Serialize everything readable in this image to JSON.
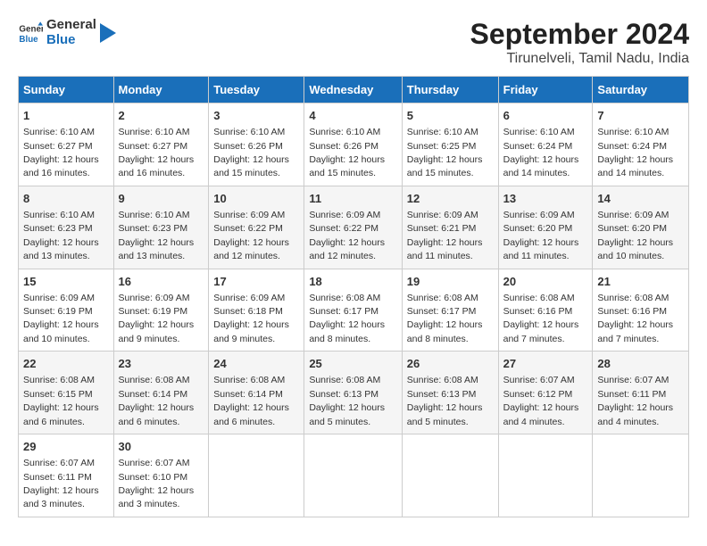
{
  "header": {
    "logo_line1": "General",
    "logo_line2": "Blue",
    "title": "September 2024",
    "subtitle": "Tirunelveli, Tamil Nadu, India"
  },
  "days_of_week": [
    "Sunday",
    "Monday",
    "Tuesday",
    "Wednesday",
    "Thursday",
    "Friday",
    "Saturday"
  ],
  "weeks": [
    [
      {
        "day": "1",
        "sunrise": "6:10 AM",
        "sunset": "6:27 PM",
        "daylight": "12 hours and 16 minutes."
      },
      {
        "day": "2",
        "sunrise": "6:10 AM",
        "sunset": "6:27 PM",
        "daylight": "12 hours and 16 minutes."
      },
      {
        "day": "3",
        "sunrise": "6:10 AM",
        "sunset": "6:26 PM",
        "daylight": "12 hours and 15 minutes."
      },
      {
        "day": "4",
        "sunrise": "6:10 AM",
        "sunset": "6:26 PM",
        "daylight": "12 hours and 15 minutes."
      },
      {
        "day": "5",
        "sunrise": "6:10 AM",
        "sunset": "6:25 PM",
        "daylight": "12 hours and 15 minutes."
      },
      {
        "day": "6",
        "sunrise": "6:10 AM",
        "sunset": "6:24 PM",
        "daylight": "12 hours and 14 minutes."
      },
      {
        "day": "7",
        "sunrise": "6:10 AM",
        "sunset": "6:24 PM",
        "daylight": "12 hours and 14 minutes."
      }
    ],
    [
      {
        "day": "8",
        "sunrise": "6:10 AM",
        "sunset": "6:23 PM",
        "daylight": "12 hours and 13 minutes."
      },
      {
        "day": "9",
        "sunrise": "6:10 AM",
        "sunset": "6:23 PM",
        "daylight": "12 hours and 13 minutes."
      },
      {
        "day": "10",
        "sunrise": "6:09 AM",
        "sunset": "6:22 PM",
        "daylight": "12 hours and 12 minutes."
      },
      {
        "day": "11",
        "sunrise": "6:09 AM",
        "sunset": "6:22 PM",
        "daylight": "12 hours and 12 minutes."
      },
      {
        "day": "12",
        "sunrise": "6:09 AM",
        "sunset": "6:21 PM",
        "daylight": "12 hours and 11 minutes."
      },
      {
        "day": "13",
        "sunrise": "6:09 AM",
        "sunset": "6:20 PM",
        "daylight": "12 hours and 11 minutes."
      },
      {
        "day": "14",
        "sunrise": "6:09 AM",
        "sunset": "6:20 PM",
        "daylight": "12 hours and 10 minutes."
      }
    ],
    [
      {
        "day": "15",
        "sunrise": "6:09 AM",
        "sunset": "6:19 PM",
        "daylight": "12 hours and 10 minutes."
      },
      {
        "day": "16",
        "sunrise": "6:09 AM",
        "sunset": "6:19 PM",
        "daylight": "12 hours and 9 minutes."
      },
      {
        "day": "17",
        "sunrise": "6:09 AM",
        "sunset": "6:18 PM",
        "daylight": "12 hours and 9 minutes."
      },
      {
        "day": "18",
        "sunrise": "6:08 AM",
        "sunset": "6:17 PM",
        "daylight": "12 hours and 8 minutes."
      },
      {
        "day": "19",
        "sunrise": "6:08 AM",
        "sunset": "6:17 PM",
        "daylight": "12 hours and 8 minutes."
      },
      {
        "day": "20",
        "sunrise": "6:08 AM",
        "sunset": "6:16 PM",
        "daylight": "12 hours and 7 minutes."
      },
      {
        "day": "21",
        "sunrise": "6:08 AM",
        "sunset": "6:16 PM",
        "daylight": "12 hours and 7 minutes."
      }
    ],
    [
      {
        "day": "22",
        "sunrise": "6:08 AM",
        "sunset": "6:15 PM",
        "daylight": "12 hours and 6 minutes."
      },
      {
        "day": "23",
        "sunrise": "6:08 AM",
        "sunset": "6:14 PM",
        "daylight": "12 hours and 6 minutes."
      },
      {
        "day": "24",
        "sunrise": "6:08 AM",
        "sunset": "6:14 PM",
        "daylight": "12 hours and 6 minutes."
      },
      {
        "day": "25",
        "sunrise": "6:08 AM",
        "sunset": "6:13 PM",
        "daylight": "12 hours and 5 minutes."
      },
      {
        "day": "26",
        "sunrise": "6:08 AM",
        "sunset": "6:13 PM",
        "daylight": "12 hours and 5 minutes."
      },
      {
        "day": "27",
        "sunrise": "6:07 AM",
        "sunset": "6:12 PM",
        "daylight": "12 hours and 4 minutes."
      },
      {
        "day": "28",
        "sunrise": "6:07 AM",
        "sunset": "6:11 PM",
        "daylight": "12 hours and 4 minutes."
      }
    ],
    [
      {
        "day": "29",
        "sunrise": "6:07 AM",
        "sunset": "6:11 PM",
        "daylight": "12 hours and 3 minutes."
      },
      {
        "day": "30",
        "sunrise": "6:07 AM",
        "sunset": "6:10 PM",
        "daylight": "12 hours and 3 minutes."
      },
      {
        "day": "",
        "sunrise": "",
        "sunset": "",
        "daylight": ""
      },
      {
        "day": "",
        "sunrise": "",
        "sunset": "",
        "daylight": ""
      },
      {
        "day": "",
        "sunrise": "",
        "sunset": "",
        "daylight": ""
      },
      {
        "day": "",
        "sunrise": "",
        "sunset": "",
        "daylight": ""
      },
      {
        "day": "",
        "sunrise": "",
        "sunset": "",
        "daylight": ""
      }
    ]
  ]
}
